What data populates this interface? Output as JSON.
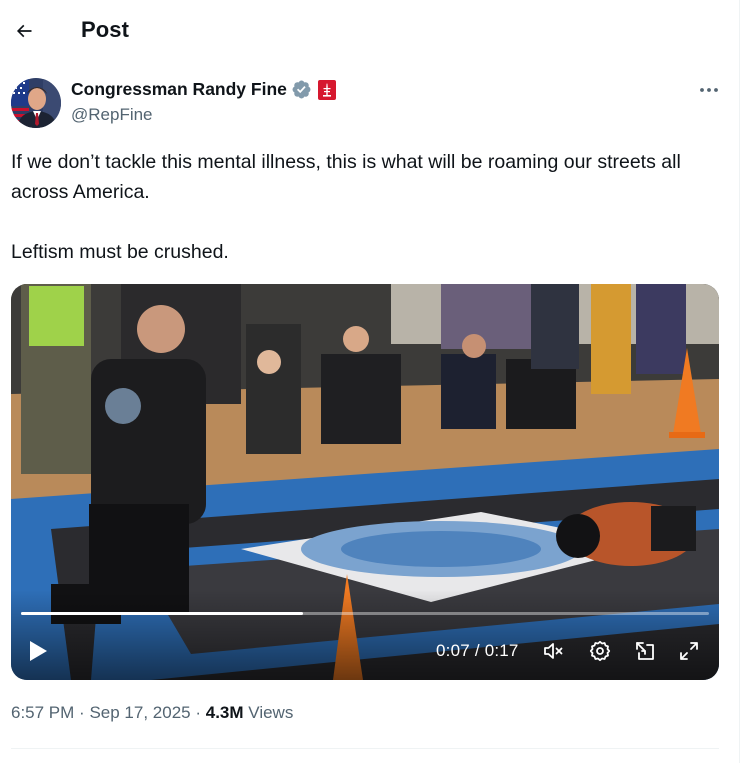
{
  "header": {
    "back_icon": "arrow-left-icon",
    "title": "Post"
  },
  "author": {
    "name": "Congressman Randy Fine",
    "handle": "@RepFine",
    "badges": [
      "verified-badge-icon",
      "government-affiliation-icon"
    ],
    "verified_color": "#829aab",
    "affiliation_color": "#d6182f"
  },
  "post": {
    "lines": [
      "If we don’t tackle this mental illness, this is what will be roaming our streets all across America.",
      "Leftism must be crushed."
    ]
  },
  "video": {
    "elapsed": "0:07",
    "separator": "/",
    "duration": "0:17",
    "progress_fraction": 0.41,
    "controls": [
      "play-icon",
      "mute-icon",
      "settings-gear-icon",
      "pop-out-icon",
      "fullscreen-icon"
    ]
  },
  "meta": {
    "time": "6:57 PM",
    "date": "Sep 17, 2025",
    "views_count": "4.3M",
    "views_label": "Views",
    "dot": "·"
  },
  "colors": {
    "text_primary": "#0f1419",
    "text_secondary": "#536471",
    "divider": "#eff3f4"
  }
}
